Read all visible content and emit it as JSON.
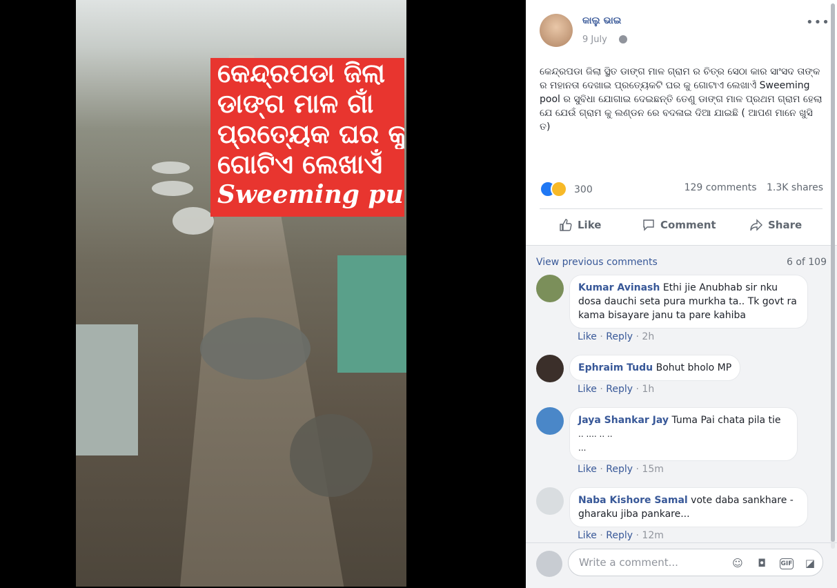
{
  "photo": {
    "banner_lines": [
      "କେନ୍ଦ୍ରପଡା ଜିଲା",
      "ଡାଙ୍ଗ ମାଳ ଗାଁ",
      "ପ୍ରତ୍ୟେକ ଘର କୁ",
      "ଗୋଟିଏ ଲେଖାଏଁ"
    ],
    "banner_english": "Sweeming pull",
    "banner_color": "#e8352f"
  },
  "post": {
    "author": "କାଲୁ ଭାଇ",
    "date": "9 July",
    "privacy_icon": "globe-icon",
    "text": "କେନ୍ଦ୍ରପଡା ଜିଲା ସ୍ଥିତ ଡାଙ୍ଗ ମାଳ ଗ୍ରାମ ର ଚିତ୍ର ସେଠା କାର ସାଂସଦ ତାଙ୍କ ର ମହାନତା ଦେଖାଇ ପ୍ରତ୍ୟେକଟି ଘର କୁ ଗୋଟାଏ ଲେଖାଏଁ Sweeming pool ର ସୁବିଧା ଯୋଗାଇ ଦେଇଛନ୍ତି ତେଣୁ ଡାଙ୍ଗ ମାଳ ପ୍ରଥମ ଗ୍ରାମ ହେଲା ଯେ ଯେଉଁ ଗ୍ରାମ କୁ ଲଣ୍ଡନ ରେ ବଦଳାଇ ଦିଆ ଯାଇଛି ( ଆପଣ ମାନେ ଖୁସି ତ)",
    "reactions_count": "300",
    "comments_count": "129 comments",
    "shares_count": "1.3K shares"
  },
  "actions": {
    "like": "Like",
    "comment": "Comment",
    "share": "Share"
  },
  "comments": {
    "view_previous": "View previous comments",
    "count_of": "6 of 109",
    "like_label": "Like",
    "reply_label": "Reply",
    "items": [
      {
        "name": "Kumar Avinash",
        "text": "Ethi jie Anubhab sir nku dosa dauchi seta pura murkha ta.. Tk govt ra kama bisayare janu ta pare kahiba",
        "time": "2h"
      },
      {
        "name": "Ephraim Tudu",
        "text": "Bohut bholo MP",
        "time": "1h"
      },
      {
        "name": "Jaya Shankar Jay",
        "text": "Tuma Pai chata pila tie",
        "text2": ".. .... .. ..",
        "text3": "...",
        "time": "15m"
      },
      {
        "name": "Naba Kishore Samal",
        "text": "vote daba sankhare - gharaku jiba pankare...",
        "time": "12m"
      }
    ],
    "write_placeholder": "Write a comment..."
  },
  "colors": {
    "link": "#385898",
    "muted": "#90949c"
  }
}
